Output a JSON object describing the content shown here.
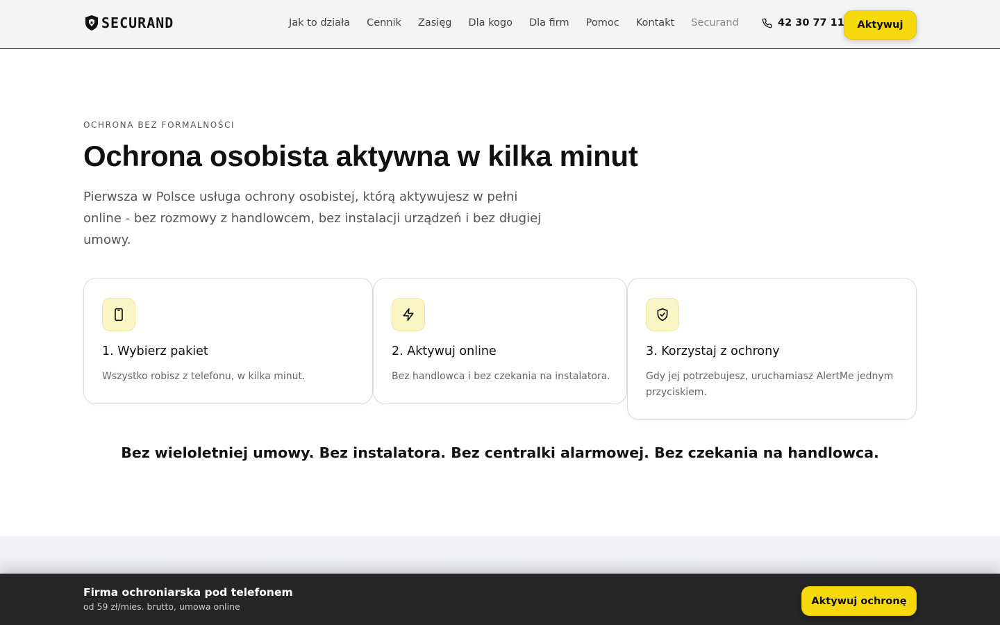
{
  "header": {
    "logo_text": "SECURAND",
    "nav": [
      {
        "label": "Jak to działa",
        "name": "nav-item-how-it-works"
      },
      {
        "label": "Cennik",
        "name": "nav-item-pricing"
      },
      {
        "label": "Zasięg",
        "name": "nav-item-coverage"
      },
      {
        "label": "Dla kogo",
        "name": "nav-item-for-whom"
      },
      {
        "label": "Dla firm",
        "name": "nav-item-business"
      },
      {
        "label": "Pomoc",
        "name": "nav-item-help"
      },
      {
        "label": "Kontakt",
        "name": "nav-item-contact"
      },
      {
        "label": "Securand",
        "name": "nav-item-securand"
      }
    ],
    "phone": "42 30 77 112",
    "phone_icon": "phone-icon",
    "cta_label": "Aktywuj"
  },
  "hero": {
    "eyebrow": "OCHRONA BEZ FORMALNOŚCI",
    "title": "Ochrona osobista aktywna w kilka minut",
    "description": "Pierwsza w Polsce usługa ochrony osobistej, którą aktywujesz w pełni online - bez rozmowy z handlowcem, bez instalacji urządzeń i bez długiej umowy."
  },
  "steps": [
    {
      "icon": "smartphone-icon",
      "title": "1. Wybierz pakiet",
      "text": "Wszystko robisz z telefonu, w kilka minut."
    },
    {
      "icon": "lightning-icon",
      "title": "2. Aktywuj online",
      "text": "Bez handlowca i bez czekania na instalatora."
    },
    {
      "icon": "shield-check-icon",
      "title": "3. Korzystaj z ochrony",
      "text": "Gdy jej potrzebujesz, uruchamiasz AlertMe jednym przyciskiem."
    }
  ],
  "tagline": "Bez wieloletniej umowy. Bez instalatora. Bez centralki alarmowej. Bez czekania na handlowca.",
  "sticky_bar": {
    "title": "Firma ochroniarska pod telefonem",
    "subtitle": "od 59 zł/mies. brutto, umowa online",
    "cta_label": "Aktywuj ochronę"
  },
  "colors": {
    "accent": "#f5d90a",
    "icon_bg": "#fbf4c4",
    "sticky_bg": "#262626",
    "header_bg": "#f4f4f4"
  }
}
